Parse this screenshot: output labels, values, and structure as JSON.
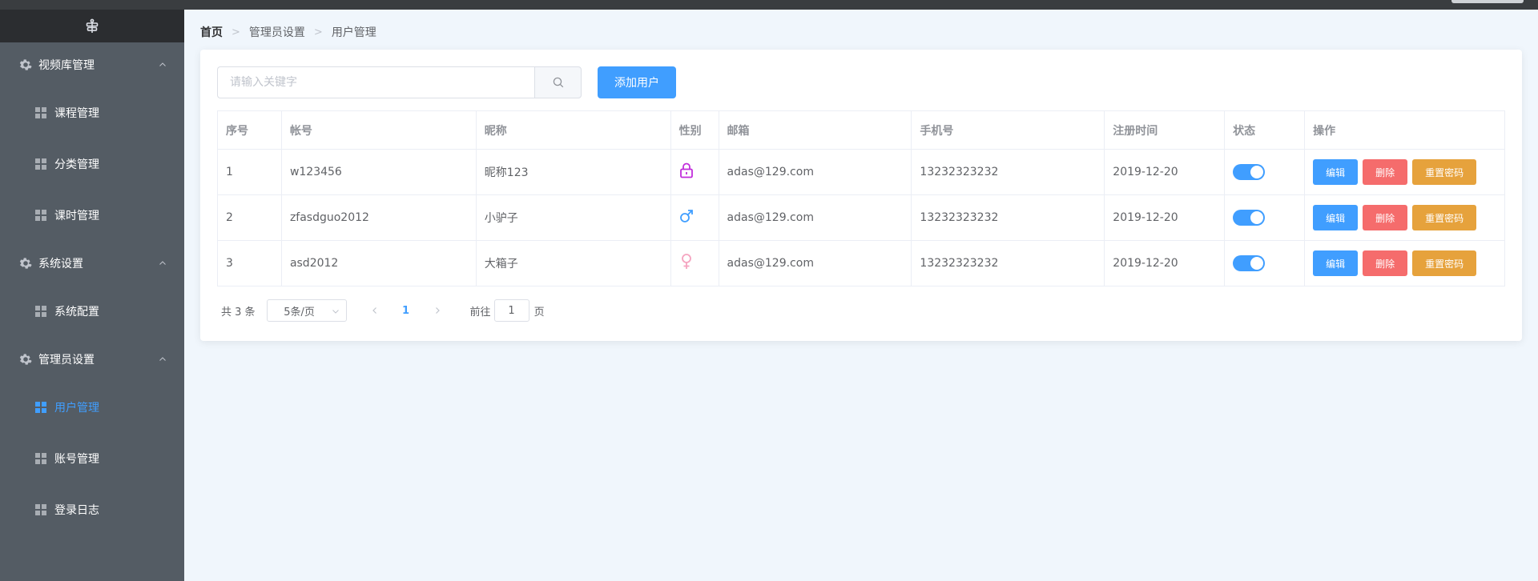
{
  "sidebar": {
    "groups": [
      {
        "label": "视频库管理",
        "items": [
          "课程管理",
          "分类管理",
          "课时管理"
        ]
      },
      {
        "label": "系统设置",
        "items": [
          "系统配置"
        ]
      },
      {
        "label": "管理员设置",
        "items": [
          "用户管理",
          "账号管理",
          "登录日志"
        ]
      }
    ],
    "active_item": "用户管理"
  },
  "breadcrumb": [
    "首页",
    "管理员设置",
    "用户管理"
  ],
  "search": {
    "placeholder": "请输入关键字",
    "value": ""
  },
  "add_button": "添加用户",
  "table": {
    "columns": [
      "序号",
      "帐号",
      "昵称",
      "性别",
      "邮箱",
      "手机号",
      "注册时间",
      "状态",
      "操作"
    ],
    "rows": [
      {
        "index": "1",
        "account": "w123456",
        "nickname": "昵称123",
        "gender_icon": "lock-icon",
        "email": "adas@129.com",
        "phone": "13232323232",
        "registered": "2019-12-20",
        "enabled": true
      },
      {
        "index": "2",
        "account": "zfasdguo2012",
        "nickname": "小驴子",
        "gender_icon": "male-icon",
        "email": "adas@129.com",
        "phone": "13232323232",
        "registered": "2019-12-20",
        "enabled": true
      },
      {
        "index": "3",
        "account": "asd2012",
        "nickname": "大箱子",
        "gender_icon": "female-icon",
        "email": "adas@129.com",
        "phone": "13232323232",
        "registered": "2019-12-20",
        "enabled": true
      }
    ],
    "actions": {
      "edit": "编辑",
      "delete": "删除",
      "reset": "重置密码"
    }
  },
  "pagination": {
    "total": "共 3 条",
    "page_size": "5条/页",
    "current": "1",
    "goto_label": "前往",
    "goto_value": "1",
    "goto_suffix": "页"
  },
  "colors": {
    "primary": "#409eff",
    "danger": "#f56c6c",
    "warning": "#e6a23c",
    "sidebar_bg": "#545c64",
    "lock_icon": "#c12ddb",
    "male_icon": "#409eff",
    "female_icon": "#f5a4c0"
  }
}
